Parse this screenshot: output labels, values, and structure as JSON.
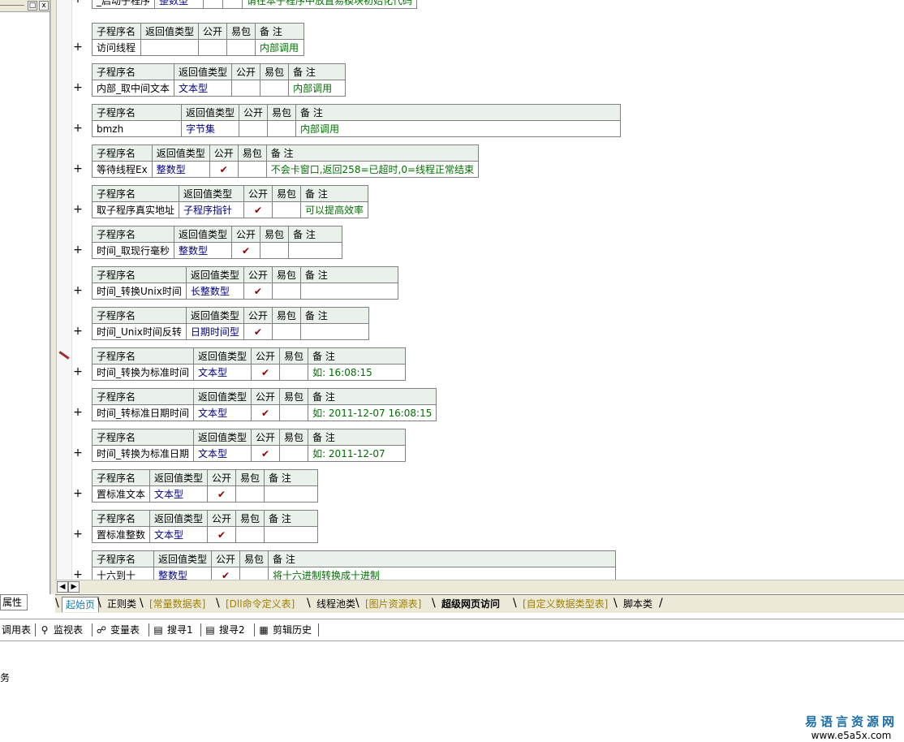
{
  "left_panel": {
    "button_restore": "□",
    "button_close": "x",
    "props_tab": "属性"
  },
  "headers": [
    "子程序名",
    "返回值类型",
    "公开",
    "易包",
    "备 注"
  ],
  "check_mark": "✔",
  "plus_mark": "+",
  "procedures": [
    {
      "name": "_启动子程序",
      "type": "整数型",
      "public": false,
      "note": "请在本子程序中放置易模块初始化代码"
    },
    {
      "name": "访问线程",
      "type": "",
      "public": false,
      "note": "内部调用"
    },
    {
      "name": "内部_取中间文本",
      "type": "文本型",
      "public": false,
      "note": "内部调用"
    },
    {
      "name": "bmzh",
      "type": "字节集",
      "public": false,
      "note": "内部调用"
    },
    {
      "name": "等待线程Ex",
      "type": "整数型",
      "public": true,
      "note": "不会卡窗口,返回258=已超时,0=线程正常结束"
    },
    {
      "name": "取子程序真实地址",
      "type": "子程序指针",
      "public": true,
      "note": "可以提高效率"
    },
    {
      "name": "时间_取现行毫秒",
      "type": "整数型",
      "public": true,
      "note": ""
    },
    {
      "name": "时间_转换Unix时间",
      "type": "长整数型",
      "public": true,
      "note": ""
    },
    {
      "name": "时间_Unix时间反转",
      "type": "日期时间型",
      "public": true,
      "note": ""
    },
    {
      "name": "时间_转换为标准时间",
      "type": "文本型",
      "public": true,
      "note": "如: 16:08:15"
    },
    {
      "name": "时间_转标准日期时间",
      "type": "文本型",
      "public": true,
      "note": "如: 2011-12-07 16:08:15"
    },
    {
      "name": "时间_转换为标准日期",
      "type": "文本型",
      "public": true,
      "note": "如: 2011-12-07"
    },
    {
      "name": "置标准文本",
      "type": "文本型",
      "public": true,
      "note": ""
    },
    {
      "name": "置标准整数",
      "type": "文本型",
      "public": true,
      "note": ""
    },
    {
      "name": "十六到十",
      "type": "整数型",
      "public": true,
      "note": "将十六进制转换成十进制"
    }
  ],
  "tabs": [
    "起始页",
    "正则类",
    "[常量数据表]",
    "[Dll命令定义表]",
    "线程池类",
    "[图片资源表]",
    "超级网页访问",
    "[自定义数据类型表]",
    "脚本类"
  ],
  "toolbar": [
    {
      "label": "调用表",
      "icon": "call-table-icon"
    },
    {
      "label": "监视表",
      "icon": "search-icon"
    },
    {
      "label": "变量表",
      "icon": "variable-icon"
    },
    {
      "label": "搜寻1",
      "icon": "search-doc-icon"
    },
    {
      "label": "搜寻2",
      "icon": "search-doc-icon"
    },
    {
      "label": "剪辑历史",
      "icon": "clipboard-icon"
    }
  ],
  "output_text": "务",
  "watermark": {
    "title": "易语言资源网",
    "url": "www.e5a5x.com"
  }
}
